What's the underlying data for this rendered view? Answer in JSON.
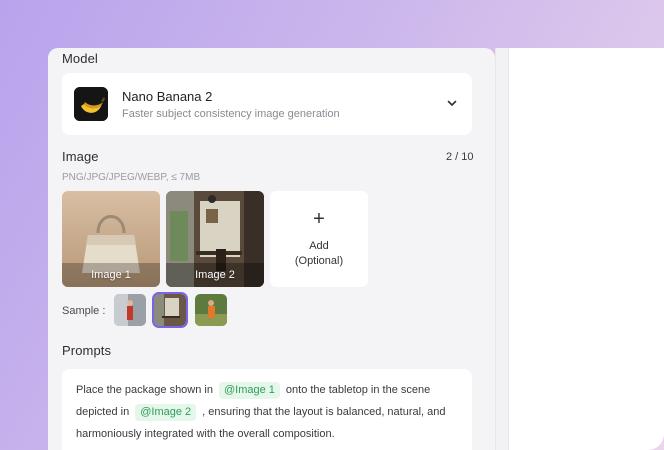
{
  "model": {
    "section_label": "Model",
    "name": "Nano Banana 2",
    "description": "Faster subject consistency image generation"
  },
  "image": {
    "section_label": "Image",
    "counter": "2 / 10",
    "formats": "PNG/JPG/JPEG/WEBP, ≤ 7MB",
    "tiles": [
      {
        "caption": "Image 1"
      },
      {
        "caption": "Image 2"
      }
    ],
    "add_plus": "+",
    "add_label_line1": "Add",
    "add_label_line2": "(Optional)",
    "sample_label": "Sample :"
  },
  "prompts": {
    "section_label": "Prompts",
    "text_1": "Place the package shown in",
    "tag_1": "@Image 1",
    "text_2": "onto the tabletop in the scene depicted in",
    "tag_2": "@Image 2",
    "text_3": ", ensuring that the layout is balanced, natural, and harmoniously integrated with the overall composition."
  },
  "colors": {
    "accent": "#7b63e6",
    "tag_bg": "#e5f6ea",
    "tag_text": "#2f9e59"
  }
}
